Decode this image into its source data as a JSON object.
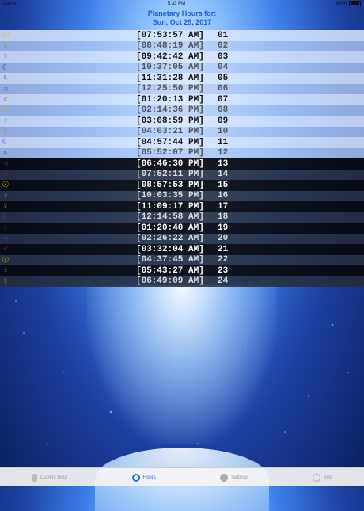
{
  "status": {
    "carrier": "Carrier",
    "time": "5:33 PM",
    "battery": "100%"
  },
  "header": {
    "line1": "Planetary Hours for:",
    "line2": "Sun, Oct 29, 2017"
  },
  "symbols": {
    "sun": {
      "glyph": "☉",
      "color": "#d6b000"
    },
    "venus": {
      "glyph": "♀",
      "color": "#2fa84f"
    },
    "mercury": {
      "glyph": "☿",
      "color": "#e07a00"
    },
    "moon": {
      "glyph": "☾",
      "color": "#4a3db0"
    },
    "saturn": {
      "glyph": "♄",
      "color": "#2a2a2a"
    },
    "jupiter": {
      "glyph": "♃",
      "color": "#3355cc"
    },
    "mars": {
      "glyph": "♂",
      "color": "#cc1f1f"
    }
  },
  "hours": [
    {
      "planet": "sun",
      "time": "[07:53:57 AM]",
      "num": "01"
    },
    {
      "planet": "venus",
      "time": "[08:48:19 AM]",
      "num": "02"
    },
    {
      "planet": "mercury",
      "time": "[09:42:42 AM]",
      "num": "03"
    },
    {
      "planet": "moon",
      "time": "[10:37:05 AM]",
      "num": "04"
    },
    {
      "planet": "saturn",
      "time": "[11:31:28 AM]",
      "num": "05"
    },
    {
      "planet": "jupiter",
      "time": "[12:25:50 PM]",
      "num": "06"
    },
    {
      "planet": "mars",
      "time": "[01:20:13 PM]",
      "num": "07"
    },
    {
      "planet": "sun",
      "time": "[02:14:36 PM]",
      "num": "08"
    },
    {
      "planet": "venus",
      "time": "[03:08:59 PM]",
      "num": "09"
    },
    {
      "planet": "mercury",
      "time": "[04:03:21 PM]",
      "num": "10"
    },
    {
      "planet": "moon",
      "time": "[04:57:44 PM]",
      "num": "11"
    },
    {
      "planet": "saturn",
      "time": "[05:52:07 PM]",
      "num": "12"
    },
    {
      "planet": "jupiter",
      "time": "[06:46:30 PM]",
      "num": "13"
    },
    {
      "planet": "mars",
      "time": "[07:52:11 PM]",
      "num": "14"
    },
    {
      "planet": "sun",
      "time": "[08:57:53 PM]",
      "num": "15"
    },
    {
      "planet": "venus",
      "time": "[10:03:35 PM]",
      "num": "16"
    },
    {
      "planet": "mercury",
      "time": "[11:09:17 PM]",
      "num": "17"
    },
    {
      "planet": "moon",
      "time": "[12:14:58 AM]",
      "num": "18"
    },
    {
      "planet": "saturn",
      "time": "[01:20:40 AM]",
      "num": "19"
    },
    {
      "planet": "jupiter",
      "time": "[02:26:22 AM]",
      "num": "20"
    },
    {
      "planet": "mars",
      "time": "[03:32:04 AM]",
      "num": "21"
    },
    {
      "planet": "sun",
      "time": "[04:37:45 AM]",
      "num": "22"
    },
    {
      "planet": "venus",
      "time": "[05:43:27 AM]",
      "num": "23"
    },
    {
      "planet": "mercury",
      "time": "[06:49:09 AM]",
      "num": "24"
    }
  ],
  "tabs": [
    {
      "label": "Current Hour",
      "icon": "hourglass-icon",
      "active": false
    },
    {
      "label": "Hours",
      "icon": "hours-clock-icon",
      "active": true
    },
    {
      "label": "Settings",
      "icon": "gear-icon",
      "active": false
    },
    {
      "label": "Info",
      "icon": "info-icon",
      "active": false
    }
  ]
}
